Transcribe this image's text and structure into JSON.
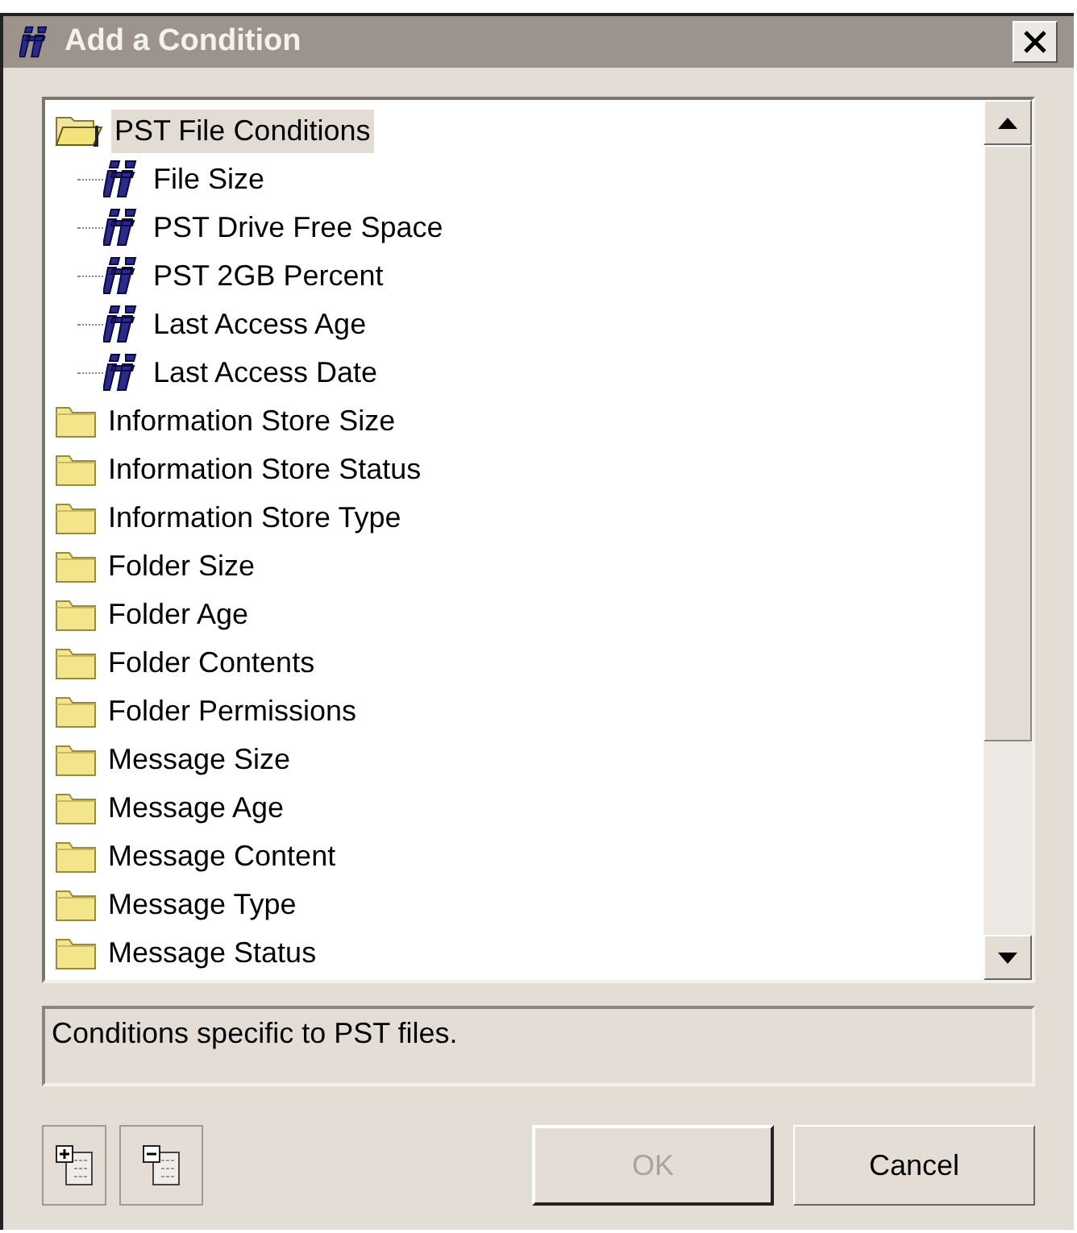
{
  "window": {
    "title": "Add a Condition"
  },
  "tree": [
    {
      "label": "PST File Conditions",
      "kind": "folder",
      "expanded": true,
      "selected": true,
      "children": [
        {
          "label": "File Size",
          "kind": "condition",
          "selected": false
        },
        {
          "label": "PST Drive Free Space",
          "kind": "condition",
          "selected": false
        },
        {
          "label": "PST 2GB Percent",
          "kind": "condition",
          "selected": false
        },
        {
          "label": "Last Access Age",
          "kind": "condition",
          "selected": false
        },
        {
          "label": "Last Access Date",
          "kind": "condition",
          "selected": false
        }
      ]
    },
    {
      "label": "Information Store Size",
      "kind": "folder",
      "expanded": false,
      "selected": false
    },
    {
      "label": "Information Store Status",
      "kind": "folder",
      "expanded": false,
      "selected": false
    },
    {
      "label": "Information Store Type",
      "kind": "folder",
      "expanded": false,
      "selected": false
    },
    {
      "label": "Folder Size",
      "kind": "folder",
      "expanded": false,
      "selected": false
    },
    {
      "label": "Folder Age",
      "kind": "folder",
      "expanded": false,
      "selected": false
    },
    {
      "label": "Folder Contents",
      "kind": "folder",
      "expanded": false,
      "selected": false
    },
    {
      "label": "Folder Permissions",
      "kind": "folder",
      "expanded": false,
      "selected": false
    },
    {
      "label": "Message Size",
      "kind": "folder",
      "expanded": false,
      "selected": false
    },
    {
      "label": "Message Age",
      "kind": "folder",
      "expanded": false,
      "selected": false
    },
    {
      "label": "Message Content",
      "kind": "folder",
      "expanded": false,
      "selected": false
    },
    {
      "label": "Message Type",
      "kind": "folder",
      "expanded": false,
      "selected": false
    },
    {
      "label": "Message Status",
      "kind": "folder",
      "expanded": false,
      "selected": false
    }
  ],
  "description": "Conditions specific to PST files.",
  "buttons": [
    {
      "label": "OK",
      "disabled": true
    },
    {
      "label": "Cancel",
      "disabled": false
    }
  ]
}
